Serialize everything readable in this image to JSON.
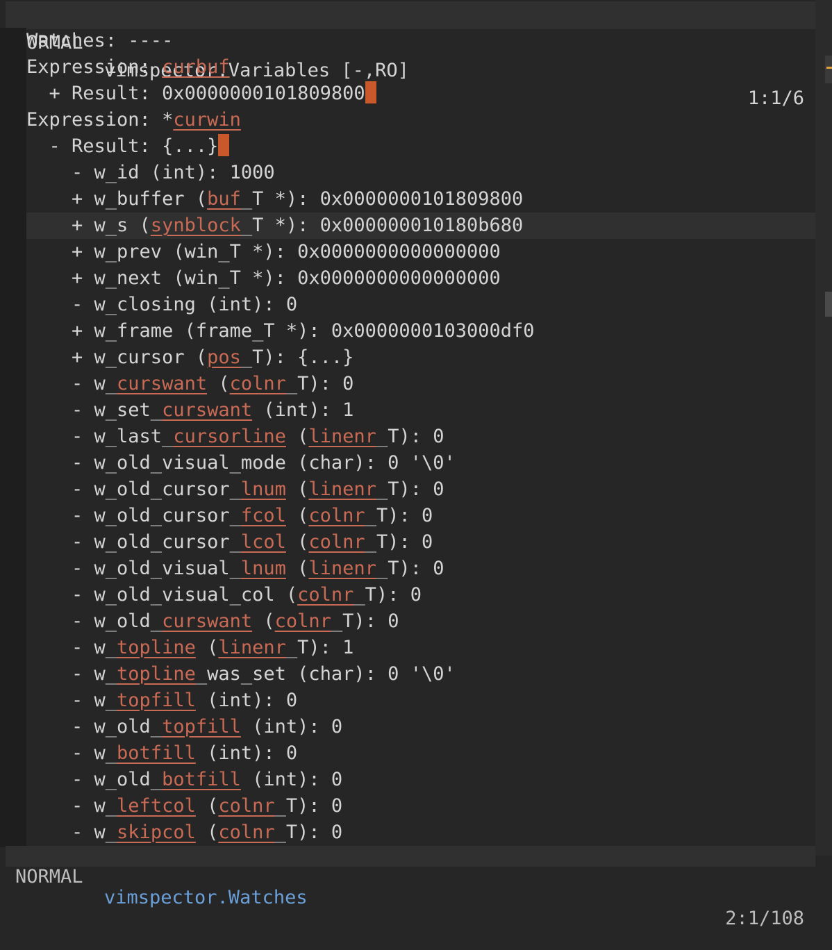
{
  "top_status": {
    "mode": "NORMAL",
    "filename": "vimspector.Variables [-,RO]",
    "position": "1:1/6"
  },
  "bottom_status": {
    "mode": "NORMAL",
    "filename": "vimspector.Watches",
    "position": "2:1/108"
  },
  "lines": [
    {
      "segments": [
        {
          "t": "Watches: ----"
        }
      ]
    },
    {
      "segments": [
        {
          "t": "Expression: "
        },
        {
          "t": "curbuf",
          "k": 1
        }
      ]
    },
    {
      "segments": [
        {
          "t": "  + Result: 0x0000000101809800"
        }
      ],
      "cursor": true
    },
    {
      "segments": [
        {
          "t": "Expression: *"
        },
        {
          "t": "curwin",
          "k": 1
        }
      ]
    },
    {
      "segments": [
        {
          "t": "  - Result: {...}"
        }
      ],
      "cursor": true
    },
    {
      "segments": [
        {
          "t": "    - w_id (int): 1000"
        }
      ]
    },
    {
      "segments": [
        {
          "t": "    + w_buffer ("
        },
        {
          "t": "buf",
          "k": 1
        },
        {
          "t": "_T *): 0x0000000101809800"
        }
      ]
    },
    {
      "segments": [
        {
          "t": "    + w_s ("
        },
        {
          "t": "synblock",
          "k": 1
        },
        {
          "t": "_T *): 0x000000010180b680"
        }
      ],
      "cursorline": true
    },
    {
      "segments": [
        {
          "t": "    + w_prev (win_T *): 0x0000000000000000"
        }
      ]
    },
    {
      "segments": [
        {
          "t": "    + w_next (win_T *): 0x0000000000000000"
        }
      ]
    },
    {
      "segments": [
        {
          "t": "    - w_closing (int): 0"
        }
      ]
    },
    {
      "segments": [
        {
          "t": "    + w_frame (frame_T *): 0x0000000103000df0"
        }
      ]
    },
    {
      "segments": [
        {
          "t": "    + w_cursor ("
        },
        {
          "t": "pos",
          "k": 1
        },
        {
          "t": "_T): {...}"
        }
      ]
    },
    {
      "segments": [
        {
          "t": "    - w_"
        },
        {
          "t": "curswant",
          "k": 1
        },
        {
          "t": " ("
        },
        {
          "t": "colnr",
          "k": 1
        },
        {
          "t": "_T): 0"
        }
      ]
    },
    {
      "segments": [
        {
          "t": "    - w_set_"
        },
        {
          "t": "curswant",
          "k": 1
        },
        {
          "t": " (int): 1"
        }
      ]
    },
    {
      "segments": [
        {
          "t": "    - w_last_"
        },
        {
          "t": "cursorline",
          "k": 1
        },
        {
          "t": " ("
        },
        {
          "t": "linenr",
          "k": 1
        },
        {
          "t": "_T): 0"
        }
      ]
    },
    {
      "segments": [
        {
          "t": "    - w_old_visual_mode (char): 0 '\\0'"
        }
      ]
    },
    {
      "segments": [
        {
          "t": "    - w_old_cursor_"
        },
        {
          "t": "lnum",
          "k": 1
        },
        {
          "t": " ("
        },
        {
          "t": "linenr",
          "k": 1
        },
        {
          "t": "_T): 0"
        }
      ]
    },
    {
      "segments": [
        {
          "t": "    - w_old_cursor_"
        },
        {
          "t": "fcol",
          "k": 1
        },
        {
          "t": " ("
        },
        {
          "t": "colnr",
          "k": 1
        },
        {
          "t": "_T): 0"
        }
      ]
    },
    {
      "segments": [
        {
          "t": "    - w_old_cursor_"
        },
        {
          "t": "lcol",
          "k": 1
        },
        {
          "t": " ("
        },
        {
          "t": "colnr",
          "k": 1
        },
        {
          "t": "_T): 0"
        }
      ]
    },
    {
      "segments": [
        {
          "t": "    - w_old_visual_"
        },
        {
          "t": "lnum",
          "k": 1
        },
        {
          "t": " ("
        },
        {
          "t": "linenr",
          "k": 1
        },
        {
          "t": "_T): 0"
        }
      ]
    },
    {
      "segments": [
        {
          "t": "    - w_old_visual_col ("
        },
        {
          "t": "colnr",
          "k": 1
        },
        {
          "t": "_T): 0"
        }
      ]
    },
    {
      "segments": [
        {
          "t": "    - w_old_"
        },
        {
          "t": "curswant",
          "k": 1
        },
        {
          "t": " ("
        },
        {
          "t": "colnr",
          "k": 1
        },
        {
          "t": "_T): 0"
        }
      ]
    },
    {
      "segments": [
        {
          "t": "    - w_"
        },
        {
          "t": "topline",
          "k": 1
        },
        {
          "t": " ("
        },
        {
          "t": "linenr",
          "k": 1
        },
        {
          "t": "_T): 1"
        }
      ]
    },
    {
      "segments": [
        {
          "t": "    - w_"
        },
        {
          "t": "topline",
          "k": 1
        },
        {
          "t": "_was_set (char): 0 '\\0'"
        }
      ]
    },
    {
      "segments": [
        {
          "t": "    - w_"
        },
        {
          "t": "topfill",
          "k": 1
        },
        {
          "t": " (int): 0"
        }
      ]
    },
    {
      "segments": [
        {
          "t": "    - w_old_"
        },
        {
          "t": "topfill",
          "k": 1
        },
        {
          "t": " (int): 0"
        }
      ]
    },
    {
      "segments": [
        {
          "t": "    - w_"
        },
        {
          "t": "botfill",
          "k": 1
        },
        {
          "t": " (int): 0"
        }
      ]
    },
    {
      "segments": [
        {
          "t": "    - w_old_"
        },
        {
          "t": "botfill",
          "k": 1
        },
        {
          "t": " (int): 0"
        }
      ]
    },
    {
      "segments": [
        {
          "t": "    - w_"
        },
        {
          "t": "leftcol",
          "k": 1
        },
        {
          "t": " ("
        },
        {
          "t": "colnr",
          "k": 1
        },
        {
          "t": "_T): 0"
        }
      ]
    },
    {
      "segments": [
        {
          "t": "    - w_"
        },
        {
          "t": "skipcol",
          "k": 1
        },
        {
          "t": " ("
        },
        {
          "t": "colnr",
          "k": 1
        },
        {
          "t": "_T): 0"
        }
      ]
    }
  ],
  "colors": {
    "background": "#262626",
    "text": "#d4d4d4",
    "keyword": "#c96a55",
    "cursor": "#c9592b"
  }
}
